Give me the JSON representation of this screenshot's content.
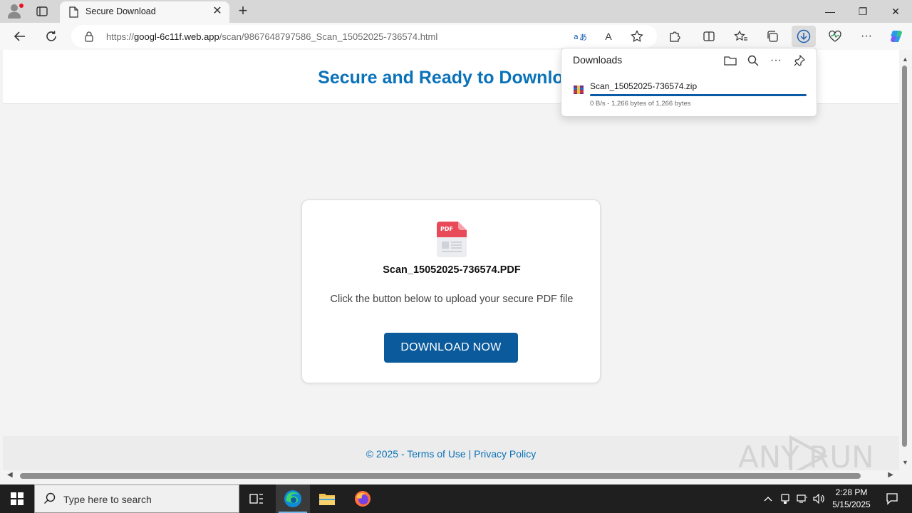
{
  "browser": {
    "tab": {
      "title": "Secure Download",
      "close": "✕"
    },
    "new_tab": "+",
    "window_controls": {
      "minimize": "—",
      "restore": "❐",
      "close": "✕"
    },
    "url": {
      "scheme": "https://",
      "host": "googl-6c11f.web.app",
      "path": "/scan/9867648797586_Scan_15052025-736574.html"
    },
    "read_aloud_label": "A",
    "more_label": "···"
  },
  "page": {
    "heading": "Secure and Ready to Download",
    "file_name": "Scan_15052025-736574.PDF",
    "pdf_badge": "PDF",
    "instruction": "Click the button below to upload your secure PDF file",
    "button_label": "DOWNLOAD NOW",
    "footer": {
      "copyright": "© 2025 - ",
      "terms": "Terms of Use",
      "separator": " | ",
      "privacy": "Privacy Policy"
    }
  },
  "downloads": {
    "title": "Downloads",
    "more_label": "···",
    "item": {
      "name": "Scan_15052025-736574.zip",
      "status": "0 B/s - 1,266 bytes of 1,266 bytes",
      "progress": 1.0
    }
  },
  "watermark": {
    "text": "ANY  RUN"
  },
  "taskbar": {
    "search_placeholder": "Type here to search",
    "time": "2:28 PM",
    "date": "5/15/2025"
  },
  "colors": {
    "accent": "#0a72b8",
    "button": "#0a5a9c",
    "progress": "#0a5aa8",
    "pdf_red": "#e84a5a"
  }
}
